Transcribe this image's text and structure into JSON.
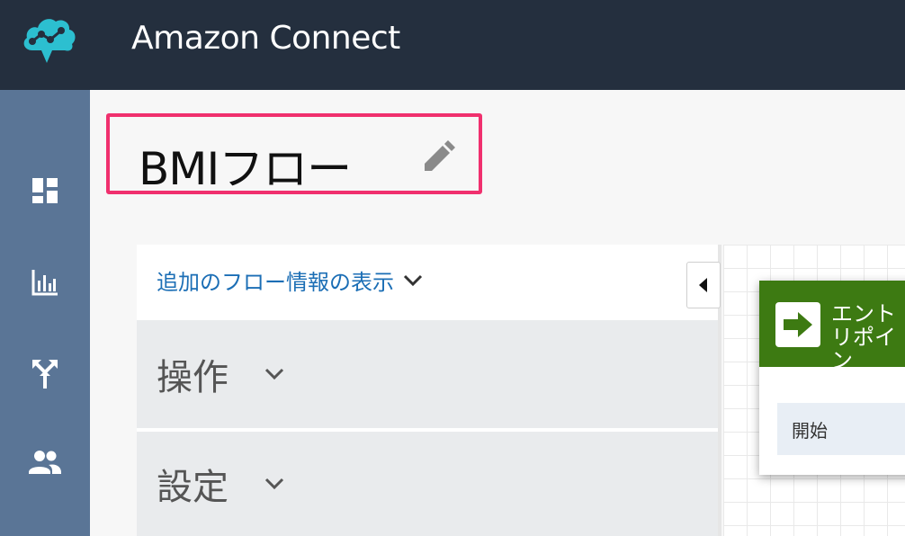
{
  "header": {
    "app_title": "Amazon Connect",
    "logo_icon": "cloud-network-icon"
  },
  "sidebar": {
    "items": [
      {
        "name": "dashboard",
        "icon": "dashboard-icon"
      },
      {
        "name": "metrics",
        "icon": "bar-chart-icon"
      },
      {
        "name": "routing",
        "icon": "routing-icon"
      },
      {
        "name": "users",
        "icon": "users-icon"
      }
    ]
  },
  "flow": {
    "title": "BMIフロー",
    "edit_icon": "pencil-icon"
  },
  "panel": {
    "more_info_label": "追加のフロー情報の表示",
    "sections": [
      {
        "label": "操作"
      },
      {
        "label": "設定"
      }
    ]
  },
  "canvas": {
    "entry_block": {
      "title_lines": [
        "エント",
        "リポイン",
        "ト"
      ],
      "row_label": "開始"
    }
  },
  "colors": {
    "topbar": "#242f3e",
    "sidebar": "#5a7596",
    "highlight": "#f0306e",
    "entry_block": "#3d7a12",
    "link": "#1b6eb5"
  }
}
